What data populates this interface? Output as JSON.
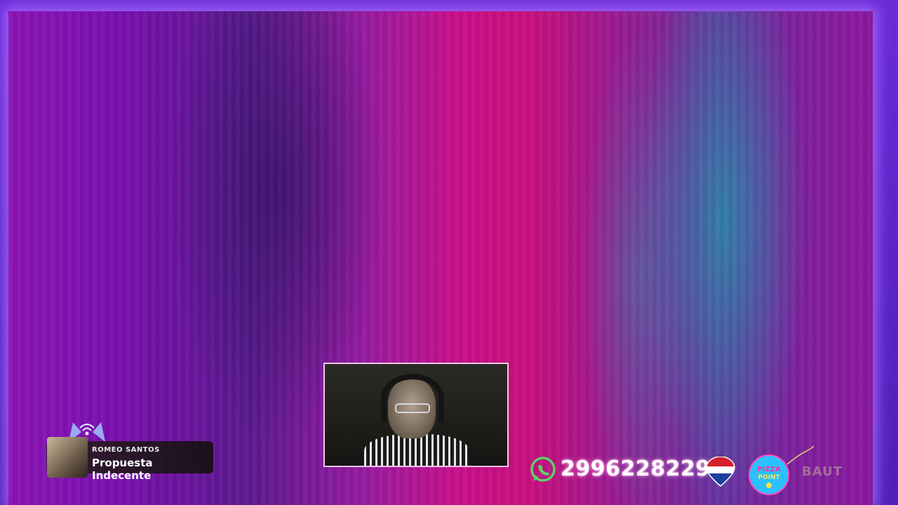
{
  "overlay": {
    "now_playing": {
      "artist": "ROMEO SANTOS",
      "title": "Propuesta Indecente"
    },
    "contact": {
      "phone": "2996228229",
      "icon": "whatsapp-icon"
    },
    "sponsors": {
      "pizza_badge_line1": "PIZZA",
      "pizza_badge_line2": "POINT",
      "partner_text": "BAUT"
    }
  },
  "colors": {
    "frame": "#6a2bd6",
    "background_magenta": "#c80f8a",
    "background_purple": "#7a0fb0",
    "background_teal": "#2f8ca8",
    "webcam_border": "#f4c6e8",
    "whatsapp_green": "#5fcf6a",
    "pizza_badge": "#2bc0ff"
  }
}
